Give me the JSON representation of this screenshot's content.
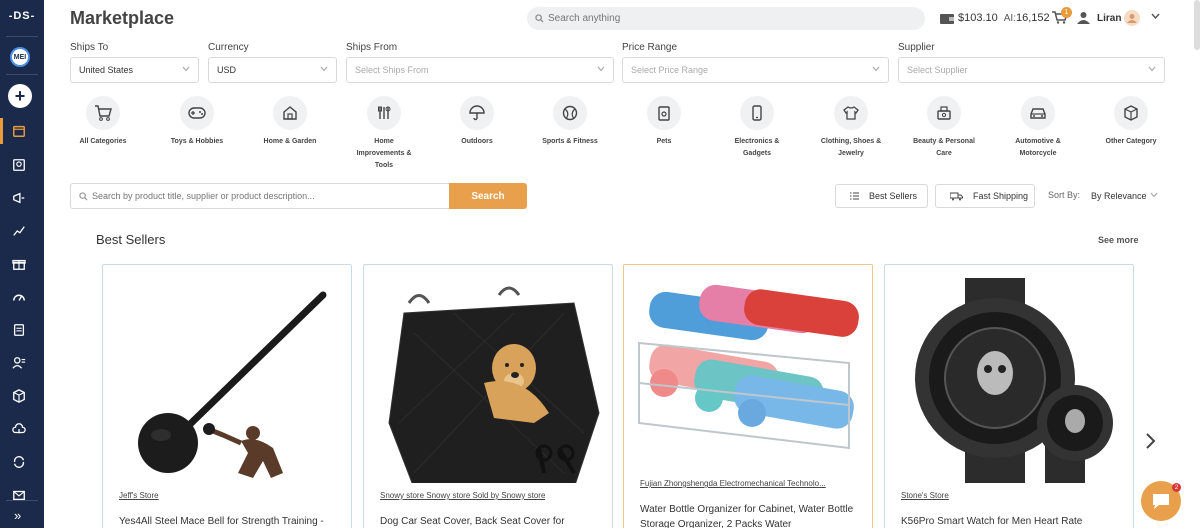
{
  "sidebar": {
    "logo": "-DS-",
    "avatar_initials": "MEI",
    "plus": "+",
    "collapse": "»",
    "items": [
      {
        "icon": "marketplace-icon"
      },
      {
        "icon": "products-icon"
      },
      {
        "icon": "campaign-icon"
      },
      {
        "icon": "analytics-icon"
      },
      {
        "icon": "gift-icon"
      },
      {
        "icon": "speed-icon"
      },
      {
        "icon": "orders-icon"
      },
      {
        "icon": "customers-icon"
      },
      {
        "icon": "package-icon"
      },
      {
        "icon": "cloud-upload-icon"
      },
      {
        "icon": "sync-icon"
      },
      {
        "icon": "mail-icon"
      }
    ]
  },
  "header": {
    "title": "Marketplace",
    "search_placeholder": "Search anything",
    "balance": "$103.10",
    "ai_label": "AI:",
    "ai_value": "16,152",
    "cart_count": "1",
    "user_name": "Liran"
  },
  "filters": [
    {
      "label": "Ships To",
      "value": "United States",
      "placeholder": false
    },
    {
      "label": "Currency",
      "value": "USD",
      "placeholder": false
    },
    {
      "label": "Ships From",
      "value": "Select Ships From",
      "placeholder": true
    },
    {
      "label": "Price Range",
      "value": "Select Price Range",
      "placeholder": true
    },
    {
      "label": "Supplier",
      "value": "Select Supplier",
      "placeholder": true
    }
  ],
  "categories": [
    {
      "label": "All Categories",
      "icon": "cart-icon"
    },
    {
      "label": "Toys & Hobbies",
      "icon": "gamepad-icon"
    },
    {
      "label": "Home & Garden",
      "icon": "home-icon"
    },
    {
      "label": "Home Improvements & Tools",
      "icon": "tools-icon"
    },
    {
      "label": "Outdoors",
      "icon": "umbrella-icon"
    },
    {
      "label": "Sports & Fitness",
      "icon": "ball-icon"
    },
    {
      "label": "Pets",
      "icon": "pet-food-icon"
    },
    {
      "label": "Electronics & Gadgets",
      "icon": "phone-icon"
    },
    {
      "label": "Clothing, Shoes & Jewelry",
      "icon": "shirt-icon"
    },
    {
      "label": "Beauty & Personal Care",
      "icon": "makeup-icon"
    },
    {
      "label": "Automotive & Motorcycle",
      "icon": "car-icon"
    },
    {
      "label": "Other Category",
      "icon": "box-icon"
    }
  ],
  "search": {
    "placeholder": "Search by product title, supplier or product description...",
    "button": "Search",
    "best_sellers": "Best Sellers",
    "fast_shipping": "Fast Shipping",
    "sort_label": "Sort By:",
    "sort_value": "By Relevance"
  },
  "best_sellers": {
    "title": "Best Sellers",
    "see_more": "See more",
    "products": [
      {
        "store": "Jeff's Store",
        "title": "Yes4All Steel Mace Bell for Strength Training -"
      },
      {
        "store": "Snowy store Snowy store Sold by Snowy store",
        "title": "Dog Car Seat Cover, Back Seat Cover for"
      },
      {
        "store": "Fujian Zhongshengda Electromechanical Technolo...",
        "title": "Water Bottle Organizer for Cabinet, Water Bottle Storage Organizer, 2 Packs Water"
      },
      {
        "store": "Stone's Store",
        "title": "K56Pro Smart Watch for Men Heart Rate"
      }
    ]
  },
  "chat_badge": "2"
}
